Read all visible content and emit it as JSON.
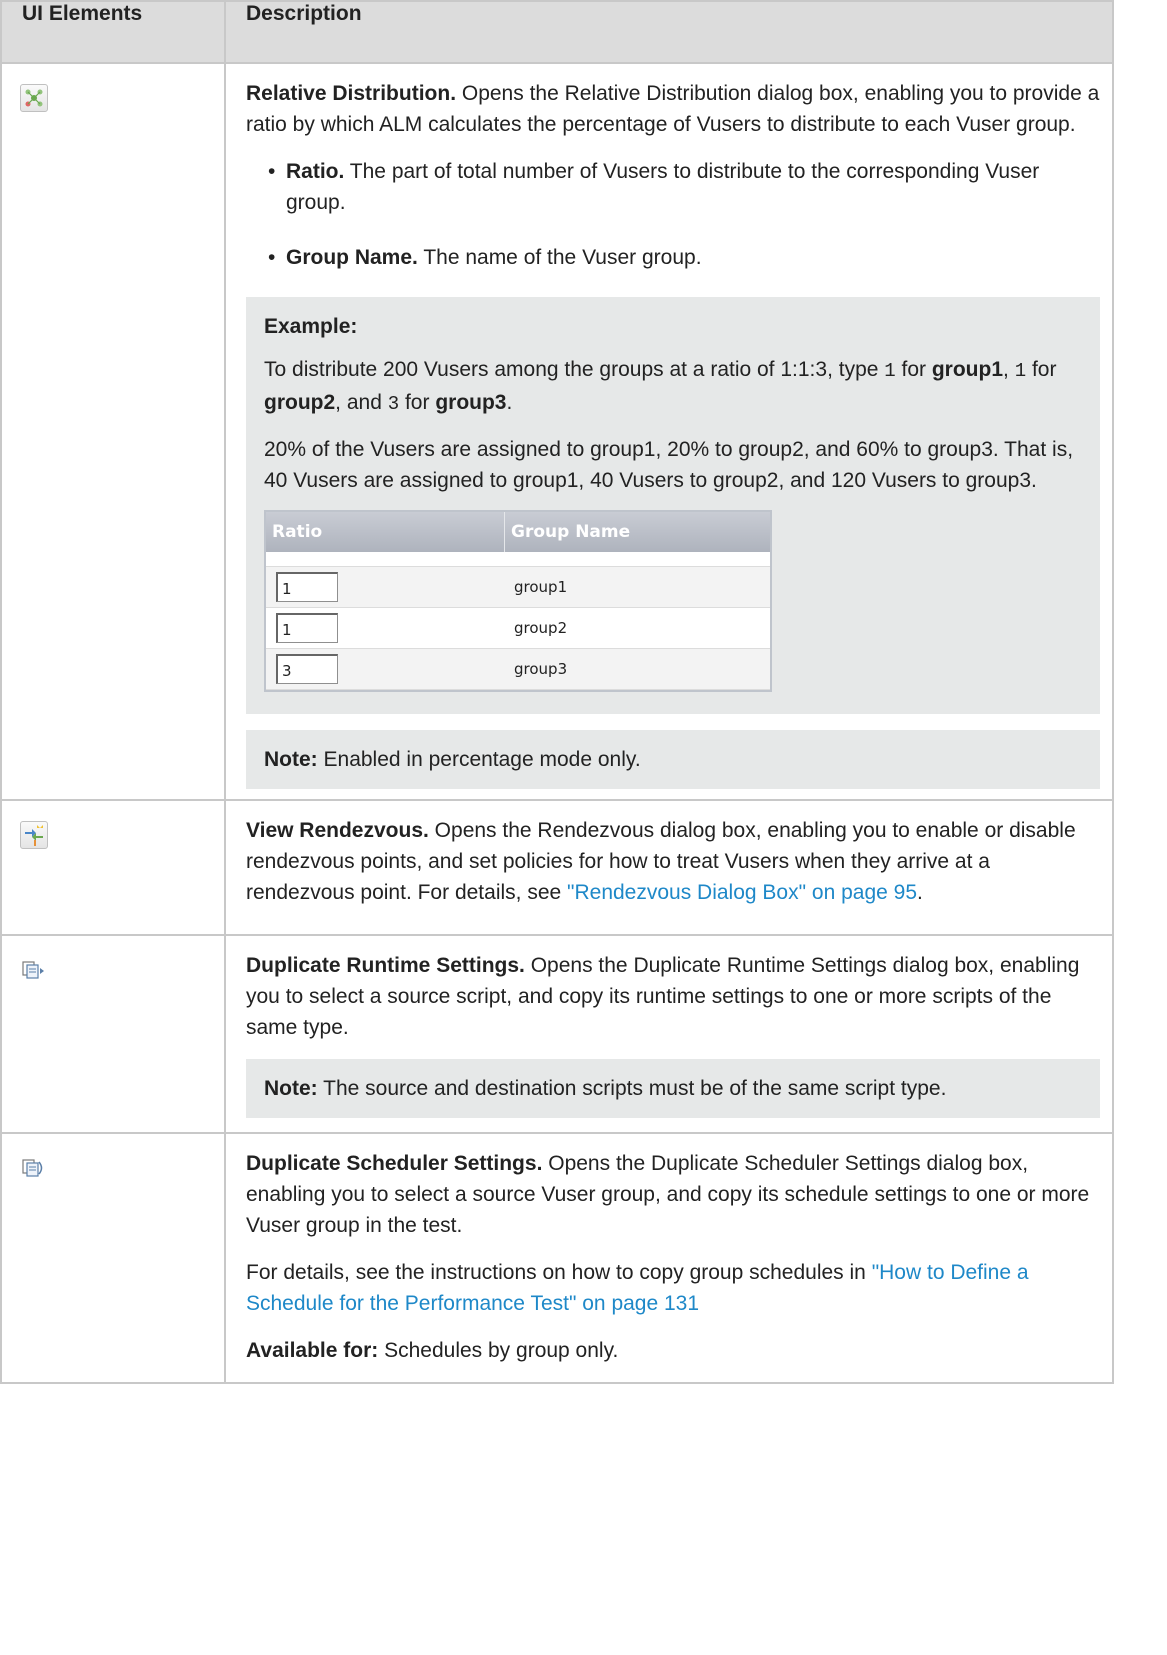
{
  "header": {
    "col1": "UI Elements",
    "col2": "Description"
  },
  "rows": {
    "relative": {
      "icon": "relative-distribution-icon",
      "title": "Relative Distribution.",
      "text": " Opens the Relative Distribution dialog box, enabling you to provide a ratio by which ALM calculates the percentage of Vusers to distribute to each Vuser group.",
      "bullet1_title": "Ratio.",
      "bullet1_text": " The part of total number of Vusers to distribute to the corresponding Vuser group.",
      "bullet2_title": "Group Name.",
      "bullet2_text": " The name of the Vuser group.",
      "example_label": "Example:",
      "example_p1_a": "To distribute 200 Vusers among the groups at a ratio of 1:1:3, type ",
      "example_p1_v1": "1",
      "example_p1_b": " for ",
      "example_p1_g1": "group1",
      "example_p1_c": ", ",
      "example_p1_v2": "1",
      "example_p1_d": " for ",
      "example_p1_g2": "group2",
      "example_p1_e": ", and ",
      "example_p1_v3": "3",
      "example_p1_f": " for ",
      "example_p1_g3": "group3",
      "example_p1_g": ".",
      "example_p2": "20% of the Vusers are assigned to group1, 20% to group2, and 60% to group3. That is, 40 Vusers are assigned to group1, 40 Vusers to group2, and 120 Vusers to group3.",
      "screenshot": {
        "col_ratio": "Ratio",
        "col_group": "Group Name",
        "rows": [
          {
            "ratio": "1",
            "group": "group1"
          },
          {
            "ratio": "1",
            "group": "group2"
          },
          {
            "ratio": "3",
            "group": "group3"
          }
        ]
      },
      "note_label": "Note:",
      "note_text": " Enabled in percentage mode only."
    },
    "rendezvous": {
      "icon": "view-rendezvous-icon",
      "title": "View Rendezvous.",
      "text": " Opens the Rendezvous dialog box, enabling you to enable or disable rendezvous points, and set policies for how to treat Vusers when they arrive at a rendezvous point. For details, see ",
      "link": "\"Rendezvous Dialog Box\" on page 95",
      "end": "."
    },
    "dup_runtime": {
      "icon": "duplicate-runtime-settings-icon",
      "title": "Duplicate Runtime Settings.",
      "text": " Opens the Duplicate Runtime Settings dialog box, enabling you to select a source script, and copy its runtime settings to one or more scripts of the same type.",
      "note_label": "Note:",
      "note_text": " The source and destination scripts must be of the same script type."
    },
    "dup_scheduler": {
      "icon": "duplicate-scheduler-settings-icon",
      "title": "Duplicate Scheduler Settings.",
      "text": " Opens the Duplicate Scheduler Settings dialog box, enabling you to select a source Vuser group, and copy its schedule settings to one or more Vuser group in the test.",
      "p2_text": "For details, see the instructions on how to copy group schedules in ",
      "p2_link": "\"How to Define a Schedule for the Performance Test\" on page 131",
      "avail_label": "Available for:",
      "avail_text": " Schedules by group only."
    }
  },
  "colors": {
    "header_bg": "#dcdcdc",
    "border": "#c8c8c8",
    "callout_bg": "#e6e8e8",
    "link": "#1e88c8"
  }
}
